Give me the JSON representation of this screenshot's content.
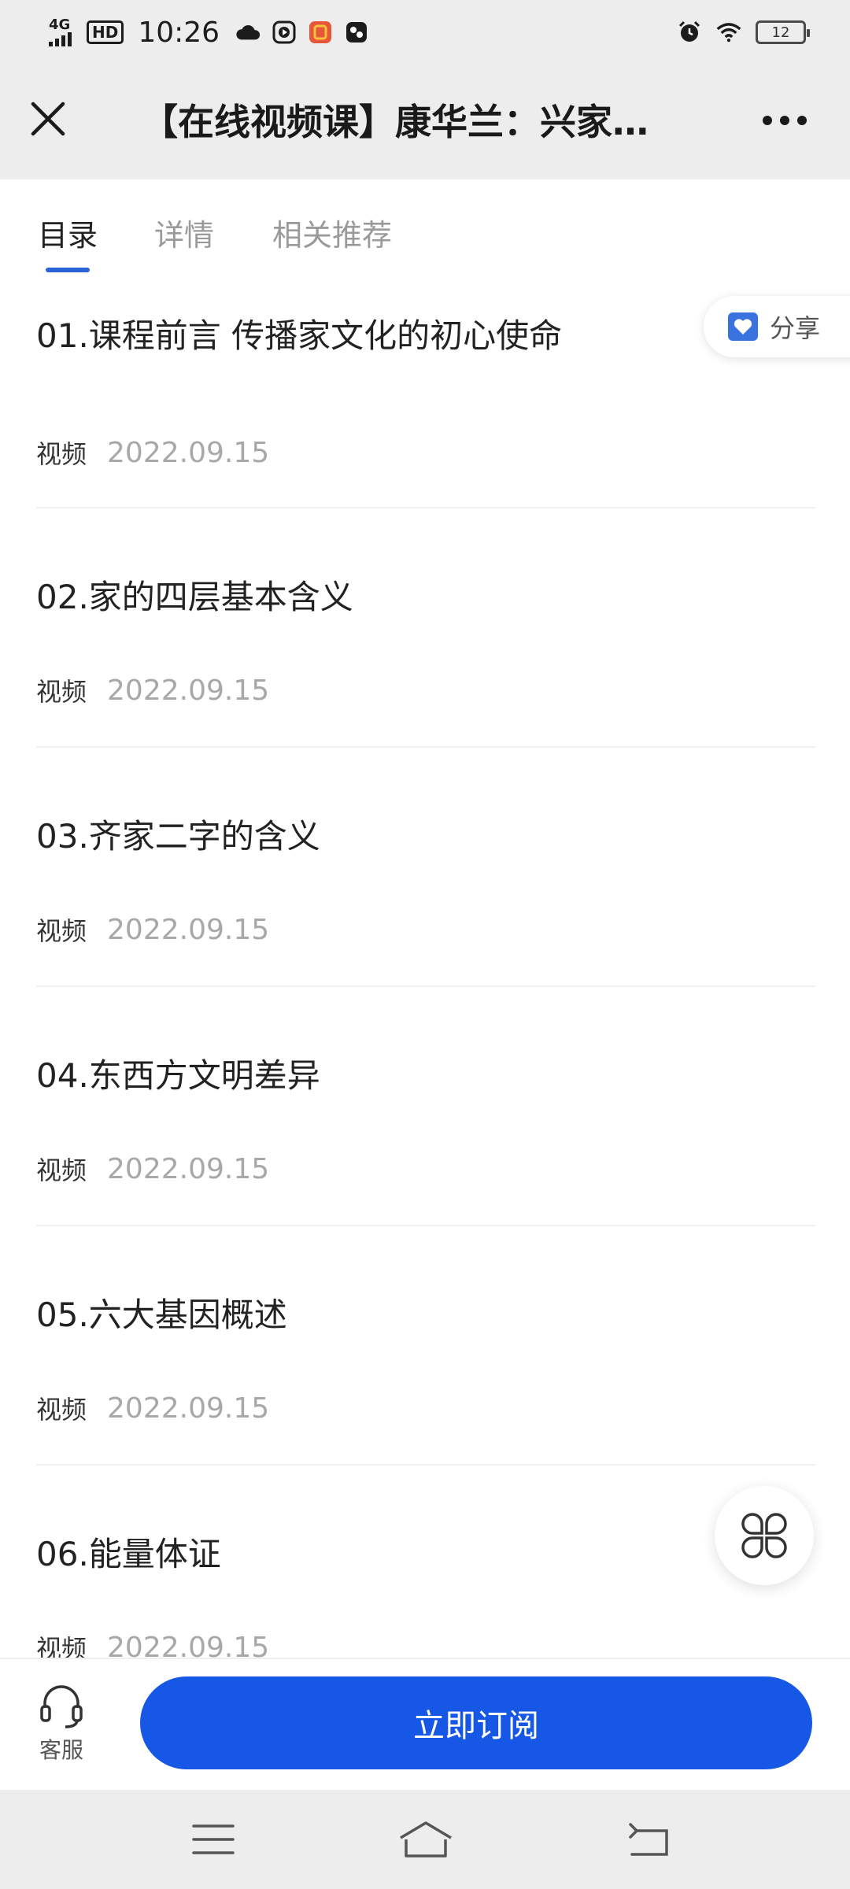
{
  "status_bar": {
    "network": "4G",
    "hd": "HD",
    "time": "10:26",
    "battery": "12"
  },
  "header": {
    "title": "【在线视频课】康华兰：兴家…"
  },
  "tabs": [
    {
      "label": "目录"
    },
    {
      "label": "详情"
    },
    {
      "label": "相关推荐"
    }
  ],
  "share": {
    "label": "分享"
  },
  "lessons": [
    {
      "title": "01.课程前言 传播家文化的初心使命",
      "type": "视频",
      "date": "2022.09.15"
    },
    {
      "title": "02.家的四层基本含义",
      "type": "视频",
      "date": "2022.09.15"
    },
    {
      "title": "03.齐家二字的含义",
      "type": "视频",
      "date": "2022.09.15"
    },
    {
      "title": "04.东西方文明差异",
      "type": "视频",
      "date": "2022.09.15"
    },
    {
      "title": "05.六大基因概述",
      "type": "视频",
      "date": "2022.09.15"
    },
    {
      "title": "06.能量体证",
      "type": "视频",
      "date": "2022.09.15"
    }
  ],
  "bottom": {
    "service_label": "客服",
    "subscribe_label": "立即订阅"
  },
  "colors": {
    "accent": "#1657e6",
    "tab_indicator": "#2a63d8",
    "chrome_bg": "#ededed"
  },
  "icons": [
    "close-icon",
    "more-icon",
    "share-icon",
    "grid-icon",
    "headset-icon",
    "menu-icon",
    "home-icon",
    "back-icon"
  ]
}
